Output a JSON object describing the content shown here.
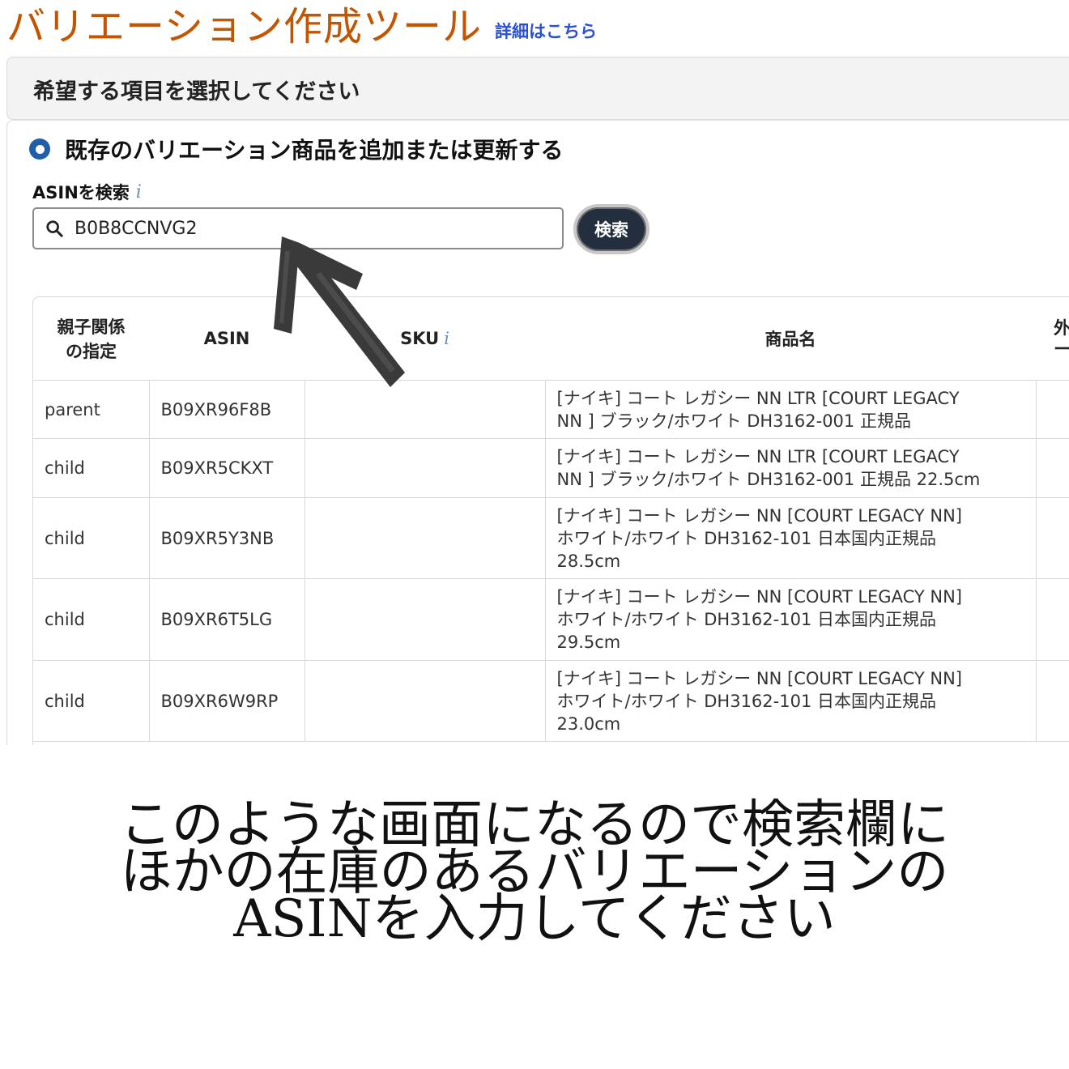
{
  "header": {
    "title": "バリエーション作成ツール",
    "details_link": "詳細はこちら"
  },
  "section": {
    "heading": "希望する項目を選択してください"
  },
  "option": {
    "radio_label": "既存のバリエーション商品を追加または更新する"
  },
  "search": {
    "label": "ASINを検索",
    "info": "i",
    "value": "B0B8CCNVG2",
    "button_label": "検索"
  },
  "table": {
    "headers": {
      "relation_line1": "親子関係",
      "relation_line2": "の指定",
      "asin": "ASIN",
      "sku": "SKU",
      "sku_info": "i",
      "name": "商品名",
      "extra_line1": "外",
      "extra_line2": "ー"
    },
    "rows": [
      {
        "relation": "parent",
        "asin": "B09XR96F8B",
        "sku": "",
        "name_lines": [
          "[ナイキ] コート レガシー NN LTR [COURT LEGACY",
          "NN ] ブラック/ホワイト DH3162-001 正規品"
        ]
      },
      {
        "relation": "child",
        "asin": "B09XR5CKXT",
        "sku": "",
        "name_lines": [
          "[ナイキ] コート レガシー NN LTR [COURT LEGACY",
          "NN ] ブラック/ホワイト DH3162-001 正規品 22.5cm"
        ]
      },
      {
        "relation": "child",
        "asin": "B09XR5Y3NB",
        "sku": "",
        "name_lines": [
          "[ナイキ] コート レガシー NN [COURT LEGACY NN]",
          "ホワイト/ホワイト DH3162-101 日本国内正規品",
          "28.5cm"
        ]
      },
      {
        "relation": "child",
        "asin": "B09XR6T5LG",
        "sku": "",
        "name_lines": [
          "[ナイキ] コート レガシー NN [COURT LEGACY NN]",
          "ホワイト/ホワイト DH3162-101 日本国内正規品",
          "29.5cm"
        ]
      },
      {
        "relation": "child",
        "asin": "B09XR6W9RP",
        "sku": "",
        "name_lines": [
          "[ナイキ] コート レガシー NN [COURT LEGACY NN]",
          "ホワイト/ホワイト DH3162-101 日本国内正規品",
          "23.0cm"
        ]
      }
    ]
  },
  "caption": {
    "lines": [
      "このような画面になるので検索欄に",
      "ほかの在庫のあるバリエーションの",
      "ASINを入力してください"
    ]
  },
  "colors": {
    "title": "#c45500",
    "link": "#2b50d8",
    "radio": "#1f5fa8",
    "button_bg": "#232f3e"
  }
}
